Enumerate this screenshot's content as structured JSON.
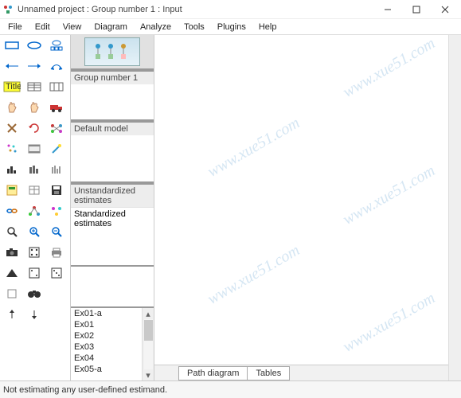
{
  "window": {
    "title": "Unnamed project : Group number 1 : Input"
  },
  "menu": [
    "File",
    "Edit",
    "View",
    "Diagram",
    "Analyze",
    "Tools",
    "Plugins",
    "Help"
  ],
  "panels": {
    "group": {
      "label": "Group number 1"
    },
    "model": {
      "label": "Default model"
    },
    "estimates": {
      "unstd": "Unstandardized estimates",
      "std": "Standardized estimates"
    }
  },
  "files": [
    "Ex01-a",
    "Ex01",
    "Ex02",
    "Ex03",
    "Ex04",
    "Ex05-a"
  ],
  "tabs": {
    "path": "Path diagram",
    "tables": "Tables"
  },
  "status": "Not estimating any user-defined estimand.",
  "watermark": "www.xue51.com",
  "tool_titles": {
    "rect": "rectangle",
    "ellipse": "ellipse",
    "latent": "latent-var",
    "arrowL": "arrow-left",
    "arrowR": "arrow-right",
    "cov": "covariance",
    "title": "title",
    "spread": "spreadsheet",
    "grid": "grid-tool",
    "hand": "hand",
    "hand2": "hand-move",
    "truck": "truck",
    "del": "delete",
    "rot": "rotate",
    "net": "network",
    "dots": "scatter",
    "film": "film",
    "wand": "wand",
    "bars": "bars",
    "bars2": "bars-alt",
    "bars3": "bars-thin",
    "calc": "calculate",
    "table2": "table",
    "save": "save",
    "chain": "chain",
    "tree": "tree",
    "nodes": "nodes",
    "mag": "zoom",
    "zin": "zoom-in",
    "zout": "zoom-out",
    "cam": "camera",
    "die": "dice",
    "print": "printer",
    "hist": "histogram",
    "d1": "dice-1",
    "d2": "dice-2",
    "misc": "misc",
    "bino": "binoculars",
    "arrU": "arrow-up",
    "arrD": "arrow-down"
  }
}
